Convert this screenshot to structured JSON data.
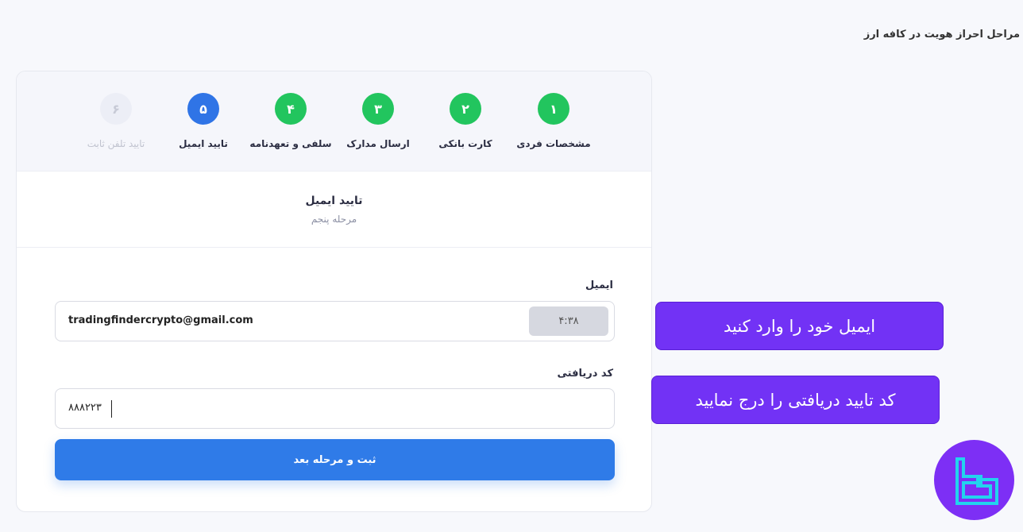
{
  "page": {
    "heading": "مراحل احراز هویت در کافه ارز"
  },
  "stepper": {
    "steps": [
      {
        "number": "۱",
        "label": "مشخصات فردی",
        "state": "done"
      },
      {
        "number": "۲",
        "label": "کارت بانکی",
        "state": "done"
      },
      {
        "number": "۳",
        "label": "ارسال مدارک",
        "state": "done"
      },
      {
        "number": "۴",
        "label": "سلفی و تعهدنامه",
        "state": "done"
      },
      {
        "number": "۵",
        "label": "تایید ایمیل",
        "state": "active"
      },
      {
        "number": "۶",
        "label": "تایید تلفن ثابت",
        "state": "pending"
      }
    ]
  },
  "section": {
    "title": "تایید ایمیل",
    "subtitle": "مرحله پنجم"
  },
  "form": {
    "email_label": "ایمیل",
    "email_value": "tradingfindercrypto@gmail.com",
    "timer": "۴:۳۸",
    "code_label": "کد دریافتی",
    "code_value": "۸۸۸۲۲۳",
    "submit_label": "ثبت و مرحله بعد"
  },
  "callouts": {
    "email": "ایمیل خود را وارد کنید",
    "code": "کد تایید دریافتی را درج نمایید"
  },
  "colors": {
    "done": "#22c55e",
    "active": "#2f74e6",
    "callout": "#7232f5",
    "logo_bg": "#7d2ff5",
    "logo_stroke": "#22d3ee"
  },
  "icons": {
    "logo": "tradingfinder-logo"
  }
}
